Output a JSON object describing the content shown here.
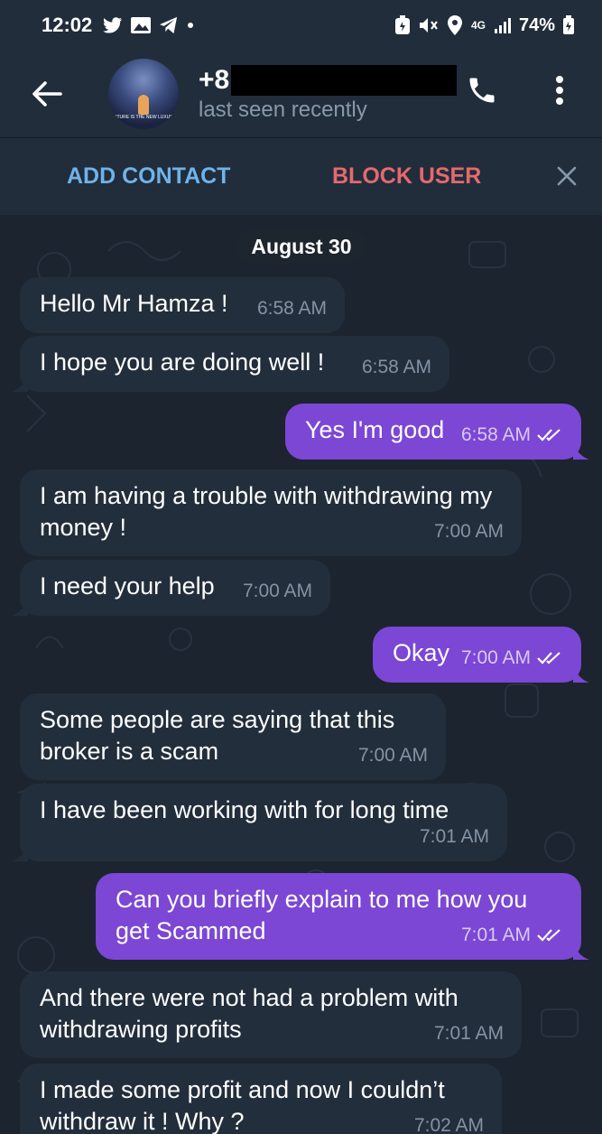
{
  "status_bar": {
    "time": "12:02",
    "battery": "74%",
    "network": "4G"
  },
  "header": {
    "contact_name_prefix": "+8",
    "contact_status": "last seen recently",
    "avatar_caption": "FUTURE IS THE NEW LUXURY"
  },
  "action_bar": {
    "add_contact_label": "ADD CONTACT",
    "block_user_label": "BLOCK USER"
  },
  "chat": {
    "date": "August 30",
    "messages": [
      {
        "direction": "in",
        "text": "Hello Mr Hamza !",
        "time": "6:58 AM"
      },
      {
        "direction": "in",
        "text": "I hope you are doing well !",
        "time": "6:58 AM"
      },
      {
        "direction": "out",
        "text": "Yes I'm good",
        "time": "6:58 AM",
        "read": true
      },
      {
        "direction": "in",
        "text": "I am having a trouble with withdrawing my money !",
        "time": "7:00 AM"
      },
      {
        "direction": "in",
        "text": "I need your help",
        "time": "7:00 AM"
      },
      {
        "direction": "out",
        "text": "Okay",
        "time": "7:00 AM",
        "read": true
      },
      {
        "direction": "in",
        "text": "Some people are saying that this broker is a scam",
        "time": "7:00 AM"
      },
      {
        "direction": "in",
        "text": "I have been working with for long time",
        "time": "7:01 AM"
      },
      {
        "direction": "out",
        "text": "Can you briefly explain to me how you get Scammed",
        "time": "7:01 AM",
        "read": true
      },
      {
        "direction": "in",
        "text": "And there were not had a problem with withdrawing profits",
        "time": "7:01 AM"
      },
      {
        "direction": "in",
        "text": "I made some profit and now I couldn’t withdraw it ! Why ?",
        "time": "7:02 AM"
      }
    ]
  },
  "colors": {
    "bar_background": "#212d3b",
    "chat_background": "#1c242f",
    "incoming_bubble": "#232e3c",
    "outgoing_bubble": "#7b47d4",
    "add_contact": "#6fb3ea",
    "block_user": "#e5696e"
  },
  "icons": [
    "twitter-icon",
    "gallery-icon",
    "telegram-icon",
    "battery-saver-icon",
    "mute-icon",
    "location-icon",
    "signal-icon",
    "battery-icon",
    "back-arrow-icon",
    "phone-icon",
    "more-vert-icon",
    "close-icon",
    "double-check-icon"
  ]
}
